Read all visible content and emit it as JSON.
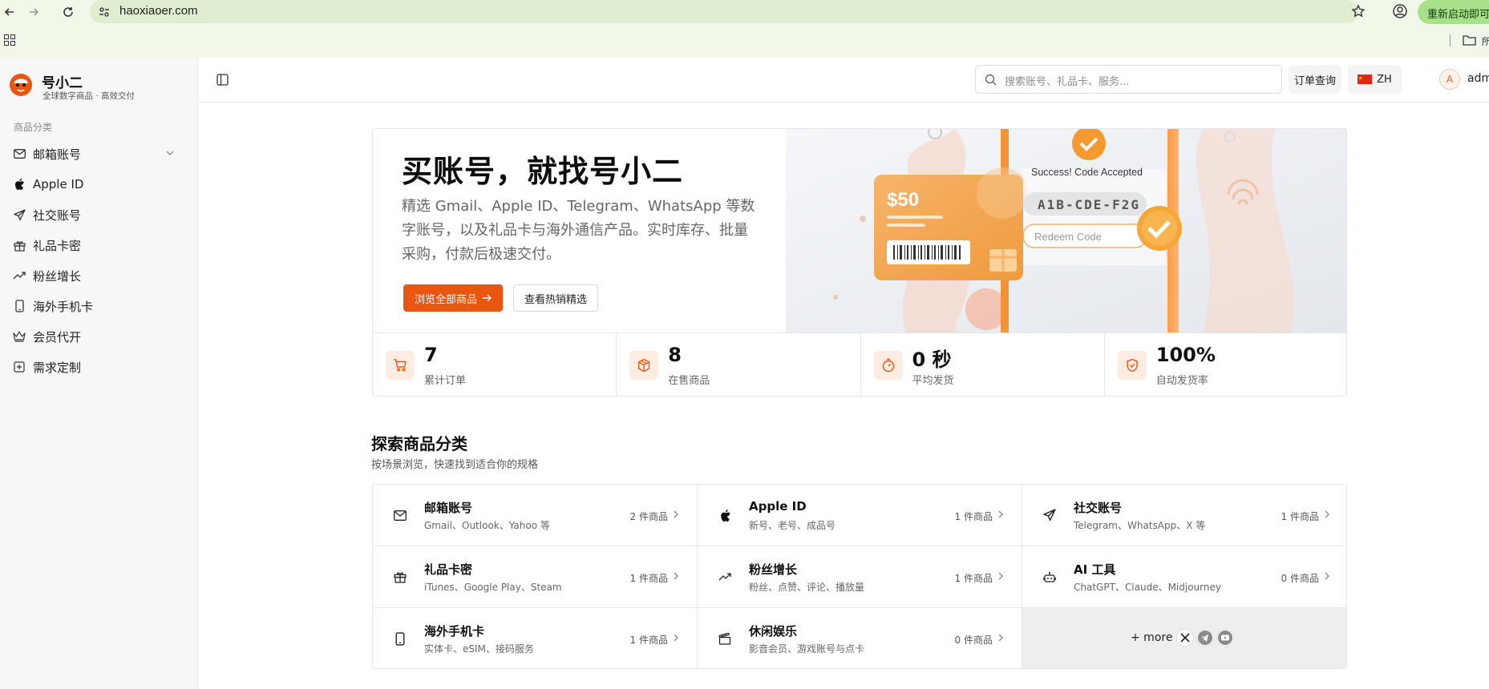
{
  "browser": {
    "url": "haoxiaoer.com",
    "restart_label": "重新启动即可更",
    "bookmark_partial": "所"
  },
  "sidebar": {
    "brand_name": "号小二",
    "brand_tagline": "全球数字商品 · 高效交付",
    "section_title": "商品分类",
    "items": [
      {
        "label": "邮箱账号",
        "icon": "mail-icon"
      },
      {
        "label": "Apple ID",
        "icon": "apple-icon"
      },
      {
        "label": "社交账号",
        "icon": "send-icon"
      },
      {
        "label": "礼品卡密",
        "icon": "gift-icon"
      },
      {
        "label": "粉丝增长",
        "icon": "trending-icon"
      },
      {
        "label": "海外手机卡",
        "icon": "phone-icon"
      },
      {
        "label": "会员代开",
        "icon": "crown-icon"
      },
      {
        "label": "需求定制",
        "icon": "plus-square-icon"
      }
    ]
  },
  "header": {
    "search_placeholder": "搜索账号、礼品卡、服务...",
    "order_lookup": "订单查询",
    "lang": "ZH",
    "avatar_initial": "A",
    "username": "adm"
  },
  "hero": {
    "title": "买账号，就找号小二",
    "description": "精选 Gmail、Apple ID、Telegram、WhatsApp 等数字账号，以及礼品卡与海外通信产品。实时库存、批量采购，付款后极速交付。",
    "primary_button": "浏览全部商品",
    "secondary_button": "查看热销精选",
    "illustration": {
      "card_amount": "$50",
      "success_text": "Success! Code Accepted",
      "code": "A1B-CDE-F2G",
      "redeem_placeholder": "Redeem Code"
    }
  },
  "stats": [
    {
      "value": "7",
      "label": "累计订单",
      "icon": "cart-icon"
    },
    {
      "value": "8",
      "label": "在售商品",
      "icon": "box-icon"
    },
    {
      "value": "0 秒",
      "label": "平均发货",
      "icon": "timer-icon"
    },
    {
      "value": "100%",
      "label": "自动发货率",
      "icon": "shield-check-icon"
    }
  ],
  "categories": {
    "title": "探索商品分类",
    "subtitle": "按场景浏览，快速找到适合你的规格",
    "items": [
      {
        "name": "邮箱账号",
        "desc": "Gmail、Outlook、Yahoo 等",
        "count": "2 件商品",
        "icon": "mail-icon"
      },
      {
        "name": "Apple ID",
        "desc": "新号、老号、成品号",
        "count": "1 件商品",
        "icon": "apple-icon"
      },
      {
        "name": "社交账号",
        "desc": "Telegram、WhatsApp、X 等",
        "count": "1 件商品",
        "icon": "send-icon"
      },
      {
        "name": "礼品卡密",
        "desc": "iTunes、Google Play、Steam",
        "count": "1 件商品",
        "icon": "gift-icon"
      },
      {
        "name": "粉丝增长",
        "desc": "粉丝、点赞、评论、播放量",
        "count": "1 件商品",
        "icon": "trending-icon"
      },
      {
        "name": "AI 工具",
        "desc": "ChatGPT、Claude、Midjourney",
        "count": "0 件商品",
        "icon": "bot-icon"
      },
      {
        "name": "海外手机卡",
        "desc": "实体卡、eSIM、接码服务",
        "count": "1 件商品",
        "icon": "phone-icon"
      },
      {
        "name": "休闲娱乐",
        "desc": "影音会员、游戏账号与点卡",
        "count": "0 件商品",
        "icon": "clapper-icon"
      }
    ],
    "more_label": "+ more"
  },
  "colors": {
    "accent": "#e8560f",
    "sidebar_bg": "#f7f7f7",
    "chrome_bg": "#f1f8ea",
    "stat_icon_bg": "#fdece2"
  }
}
